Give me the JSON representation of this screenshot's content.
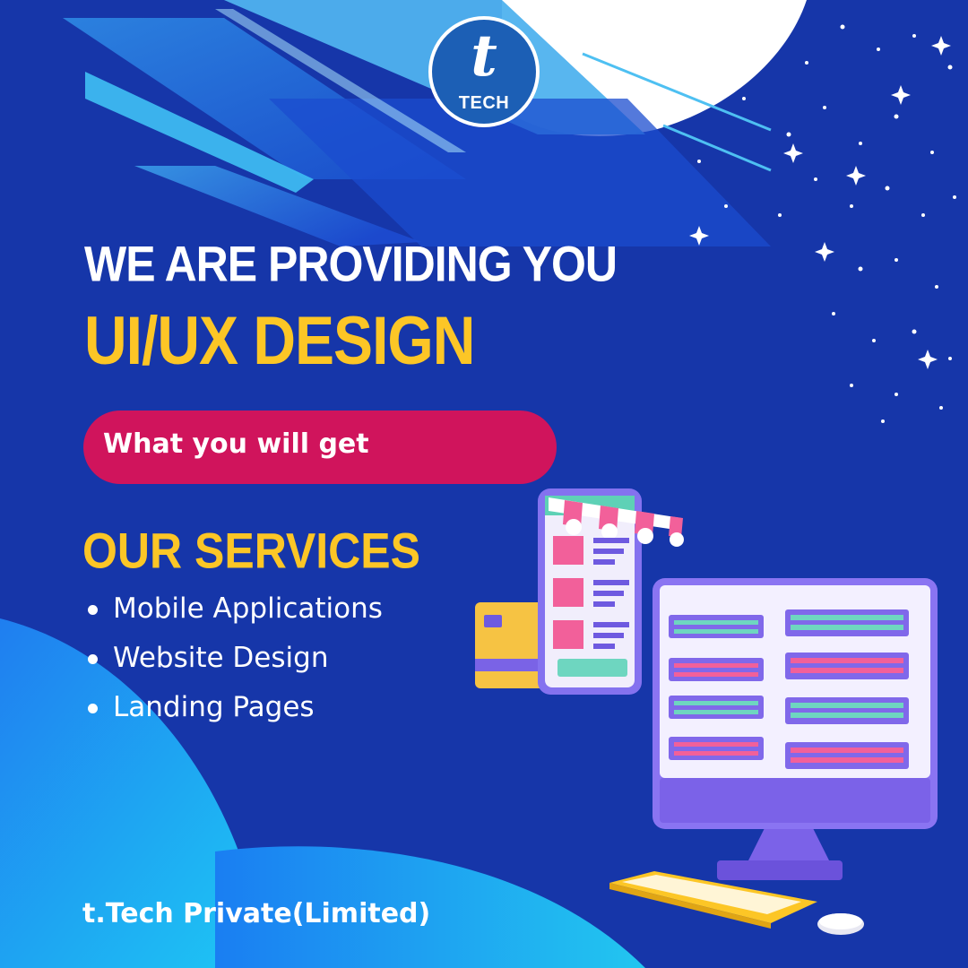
{
  "logo": {
    "mark": "t",
    "text": "TECH"
  },
  "headline": {
    "line1": "WE ARE PROVIDING YOU",
    "line2": "UI/UX DESIGN"
  },
  "cta": {
    "label": "What you will get"
  },
  "services": {
    "title": "OUR SERVICES",
    "items": [
      "Mobile Applications",
      "Website Design",
      "Landing Pages"
    ]
  },
  "footer": {
    "company": "t.Tech Private(Limited)"
  },
  "colors": {
    "background": "#1636a9",
    "accent_yellow": "#fcc626",
    "cta_pink": "#d0145c",
    "light_blue": "#1fb8f0"
  }
}
